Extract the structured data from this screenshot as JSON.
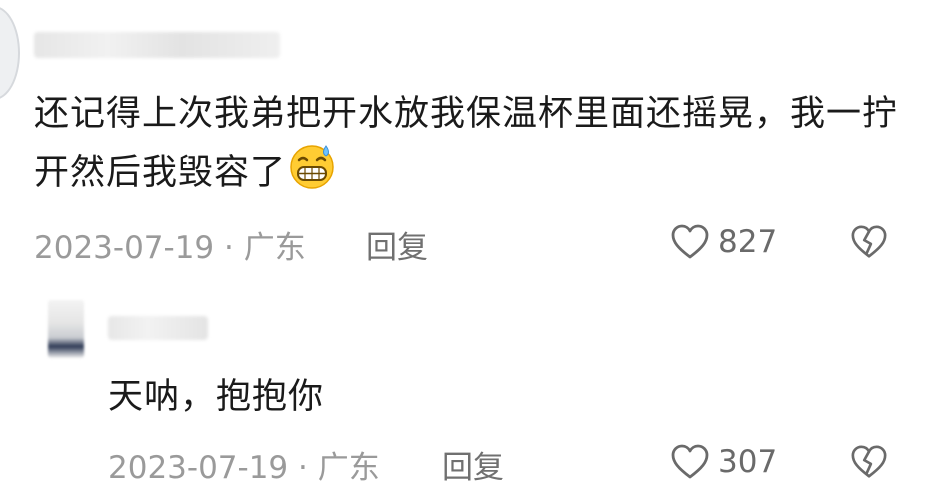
{
  "comment": {
    "text": "还记得上次我弟把开水放我保温杯里面还摇晃，我一拧开然后我毁容了",
    "emoji": "grinning-sweat-emoji",
    "date": "2023-07-19",
    "separator": "·",
    "location": "广东",
    "reply_label": "回复",
    "likes": "827"
  },
  "reply": {
    "text": "天呐，抱抱你",
    "date": "2023-07-19",
    "separator": "·",
    "location": "广东",
    "reply_label": "回复",
    "likes": "307"
  },
  "colors": {
    "text_primary": "#1a1a1a",
    "text_meta": "#9a9a9a",
    "icon": "#6a6a6a"
  }
}
